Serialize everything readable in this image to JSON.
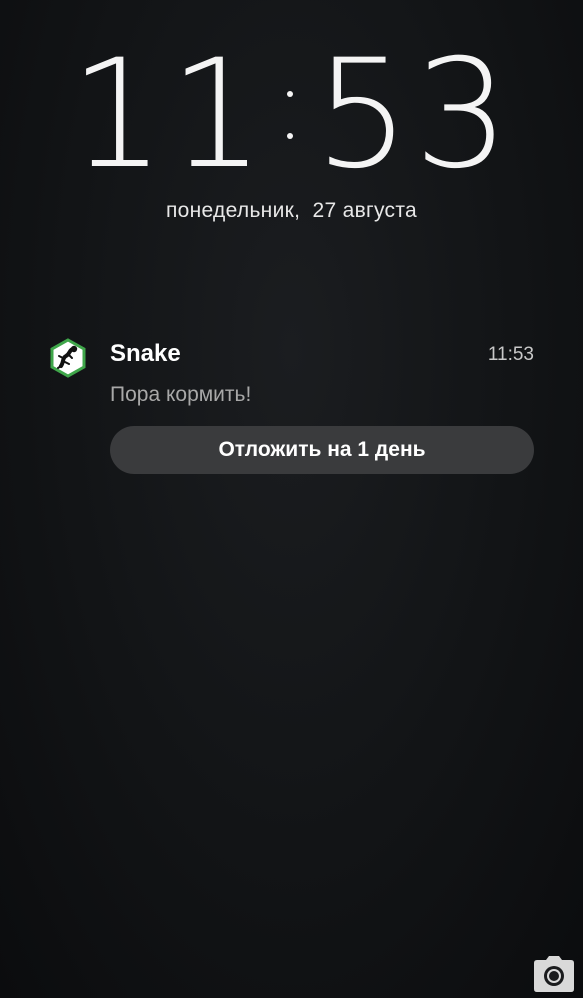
{
  "lockscreen": {
    "clock": {
      "hours": "11",
      "minutes": "53"
    },
    "date": "понедельник,  27 августа"
  },
  "notification": {
    "app_name": "Snake",
    "time": "11:53",
    "text": "Пора кормить!",
    "action_label": "Отложить на 1 день",
    "icon": "snake-app-icon"
  },
  "shortcuts": {
    "camera_icon": "camera-icon"
  },
  "colors": {
    "background": "#121416",
    "button": "#3a3b3d",
    "icon_border": "#3fa64a"
  }
}
